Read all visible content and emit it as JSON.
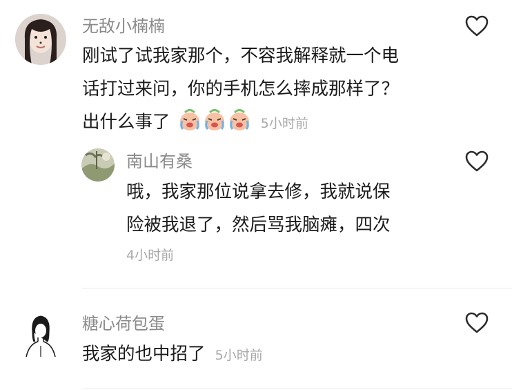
{
  "comments": [
    {
      "username": "无敌小楠楠",
      "text_lines": [
        "刚试了试我家那个，不容我解释就一个电",
        "话打过来问，你的手机怎么摔成那样了？",
        "出什么事了"
      ],
      "emoji": "crying-laugh-emoji",
      "timestamp": "5小时前",
      "reply": {
        "username": "南山有桑",
        "text_lines": [
          "哦，我家那位说拿去修，我就说保",
          "险被我退了，然后骂我脑瘫，四次"
        ],
        "timestamp": "4小时前"
      }
    },
    {
      "username": "糖心荷包蛋",
      "text_lines": [
        "我家的也中招了"
      ],
      "timestamp": "5小时前"
    }
  ],
  "icons": {
    "like": "heart-outline-icon"
  },
  "colors": {
    "username": "#8a8a8a",
    "text": "#1a1a1a",
    "timestamp": "#a8a8a8",
    "divider": "#e9e9e9"
  }
}
